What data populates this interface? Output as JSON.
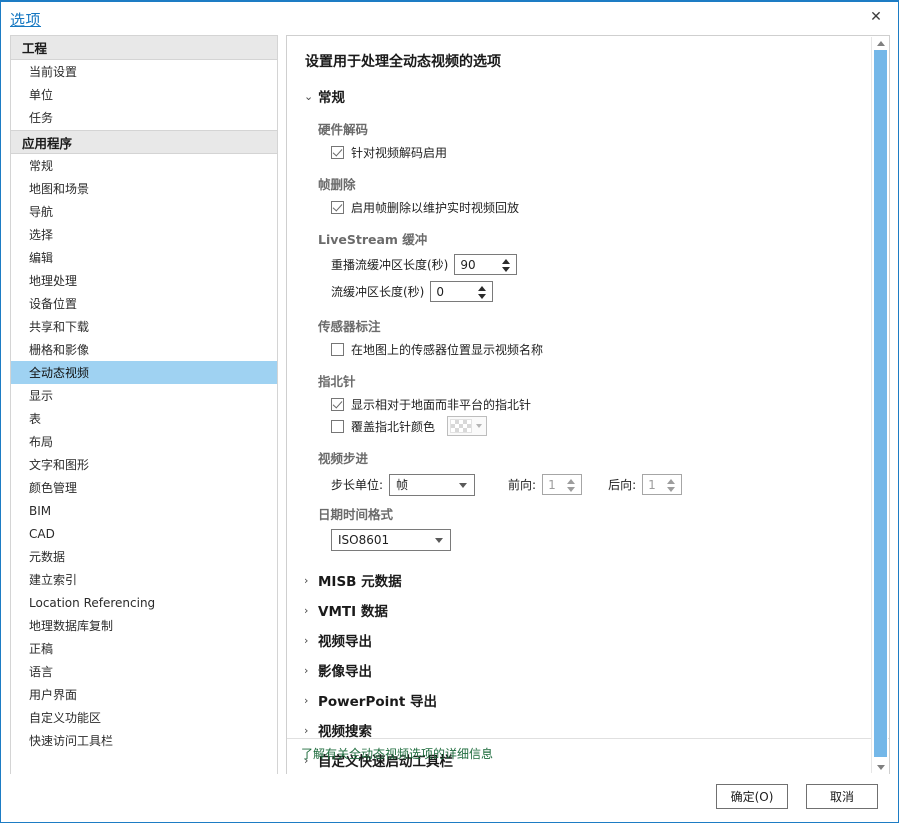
{
  "window": {
    "title": "选项",
    "close_icon": "close-icon"
  },
  "sidebar": {
    "groups": [
      {
        "header": "工程",
        "items": [
          {
            "label": "当前设置",
            "selected": false
          },
          {
            "label": "单位",
            "selected": false
          },
          {
            "label": "任务",
            "selected": false
          }
        ]
      },
      {
        "header": "应用程序",
        "items": [
          {
            "label": "常规",
            "selected": false
          },
          {
            "label": "地图和场景",
            "selected": false
          },
          {
            "label": "导航",
            "selected": false
          },
          {
            "label": "选择",
            "selected": false
          },
          {
            "label": "编辑",
            "selected": false
          },
          {
            "label": "地理处理",
            "selected": false
          },
          {
            "label": "设备位置",
            "selected": false
          },
          {
            "label": "共享和下载",
            "selected": false
          },
          {
            "label": "栅格和影像",
            "selected": false
          },
          {
            "label": "全动态视频",
            "selected": true
          },
          {
            "label": "显示",
            "selected": false
          },
          {
            "label": "表",
            "selected": false
          },
          {
            "label": "布局",
            "selected": false
          },
          {
            "label": "文字和图形",
            "selected": false
          },
          {
            "label": "颜色管理",
            "selected": false
          },
          {
            "label": "BIM",
            "selected": false
          },
          {
            "label": "CAD",
            "selected": false
          },
          {
            "label": "元数据",
            "selected": false
          },
          {
            "label": "建立索引",
            "selected": false
          },
          {
            "label": "Location Referencing",
            "selected": false
          },
          {
            "label": "地理数据库复制",
            "selected": false
          },
          {
            "label": "正稿",
            "selected": false
          },
          {
            "label": "语言",
            "selected": false
          },
          {
            "label": "用户界面",
            "selected": false
          },
          {
            "label": "自定义功能区",
            "selected": false
          },
          {
            "label": "快速访问工具栏",
            "selected": false
          }
        ]
      }
    ]
  },
  "content": {
    "heading": "设置用于处理全动态视频的选项",
    "general_section": {
      "label": "常规",
      "expanded_chevron": "⌄",
      "hardware_decode": {
        "group_label": "硬件解码",
        "checkbox_label": "针对视频解码启用",
        "checked": true
      },
      "frame_drop": {
        "group_label": "帧删除",
        "checkbox_label": "启用帧删除以维护实时视频回放",
        "checked": true
      },
      "livestream_buffer": {
        "group_label": "LiveStream 缓冲",
        "replay_label": "重播流缓冲区长度(秒)",
        "replay_value": "90",
        "stream_label": "流缓冲区长度(秒)",
        "stream_value": "0"
      },
      "sensor_annotation": {
        "group_label": "传感器标注",
        "checkbox_label": "在地图上的传感器位置显示视频名称",
        "checked": false
      },
      "compass": {
        "group_label": "指北针",
        "show_label": "显示相对于地面而非平台的指北针",
        "show_checked": true,
        "override_label": "覆盖指北针颜色",
        "override_checked": false,
        "color_swatch": "transparent-checker"
      },
      "video_step": {
        "group_label": "视频步进",
        "unit_label": "步长单位:",
        "unit_value": "帧",
        "forward_label": "前向:",
        "forward_value": "1",
        "backward_label": "后向:",
        "backward_value": "1"
      },
      "datetime_format": {
        "group_label": "日期时间格式",
        "value": "ISO8601"
      }
    },
    "collapsed_sections": [
      {
        "label": "MISB 元数据",
        "chevron": "›"
      },
      {
        "label": "VMTI 数据",
        "chevron": "›"
      },
      {
        "label": "视频导出",
        "chevron": "›"
      },
      {
        "label": "影像导出",
        "chevron": "›"
      },
      {
        "label": "PowerPoint 导出",
        "chevron": "›"
      },
      {
        "label": "视频搜索",
        "chevron": "›"
      },
      {
        "label": "自定义快速启动工具栏",
        "chevron": "›"
      }
    ],
    "help_link": "了解有关全动态视频选项的详细信息"
  },
  "footer": {
    "ok_label": "确定(O)",
    "cancel_label": "取消"
  },
  "colors": {
    "accent": "#1577c1",
    "selection": "#9fd2f2",
    "scrollbar_thumb": "#74b7e8",
    "link_green": "#1d6b3c",
    "group_label": "#6b6b6b"
  }
}
